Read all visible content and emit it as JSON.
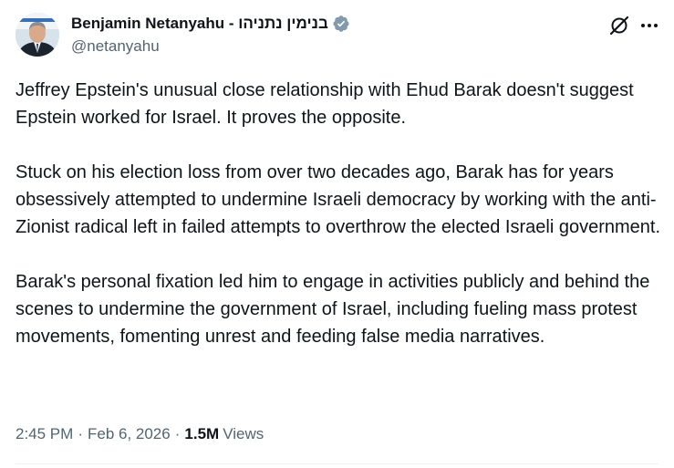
{
  "author": {
    "display_name": "Benjamin Netanyahu - בנימין נתניהו",
    "handle": "@netanyahu",
    "verified_icon": "verified-badge-icon",
    "badge_color": "#829aab"
  },
  "actions": {
    "grok_icon": "grok-icon",
    "more_icon": "more-icon"
  },
  "tweet": {
    "paragraphs": [
      "Jeffrey Epstein's unusual close relationship with Ehud Barak doesn't suggest Epstein worked for Israel. It proves the opposite.",
      "Stuck on his election loss from over two decades ago, Barak has for years obsessively attempted to undermine Israeli democracy by working with the anti-Zionist radical left in failed attempts to overthrow the elected Israeli government.",
      "Barak's personal fixation led him to engage in activities publicly and behind the scenes to undermine the government of Israel, including fueling mass protest movements, fomenting unrest and feeding false media narratives."
    ]
  },
  "meta": {
    "time": "2:45 PM",
    "separator": "·",
    "date": "Feb 6, 2026",
    "views_count": "1.5M",
    "views_label": "Views"
  },
  "colors": {
    "text": "#0f1419",
    "secondary": "#536471",
    "divider": "#eff3f4"
  }
}
